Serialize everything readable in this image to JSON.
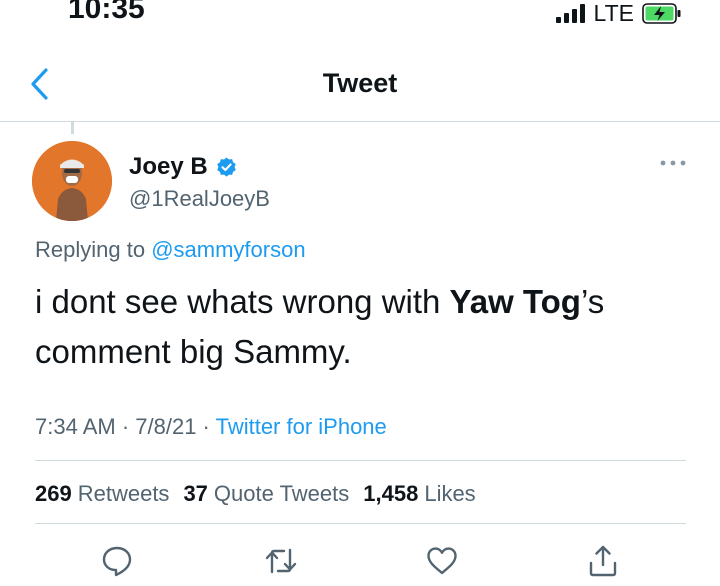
{
  "status_bar": {
    "time": "10:35",
    "network": "LTE"
  },
  "header": {
    "title": "Tweet"
  },
  "tweet": {
    "author_name": "Joey B",
    "author_handle": "@1RealJoeyB",
    "replying_prefix": "Replying to ",
    "replying_mention": "@sammyforson",
    "text_part1": "i dont see whats wrong with ",
    "text_bold": "Yaw Tog",
    "text_part2": "’s comment big Sammy.",
    "timestamp": "7:34 AM · 7/8/21 · ",
    "source": "Twitter for iPhone"
  },
  "stats": {
    "retweets_count": "269",
    "retweets_label": "Retweets",
    "quotes_count": "37",
    "quotes_label": "Quote Tweets",
    "likes_count": "1,458",
    "likes_label": "Likes"
  },
  "icons": {
    "back": "chevron-left-icon",
    "verified": "verified-badge-icon",
    "more": "more-horizontal-icon",
    "reply": "reply-icon",
    "retweet": "retweet-icon",
    "like": "heart-icon",
    "share": "share-icon"
  },
  "colors": {
    "accent": "#1d9bf0",
    "secondary_text": "#536471",
    "primary_text": "#0f1419",
    "avatar_bg": "#e2772c",
    "battery_charge": "#4cd964"
  }
}
